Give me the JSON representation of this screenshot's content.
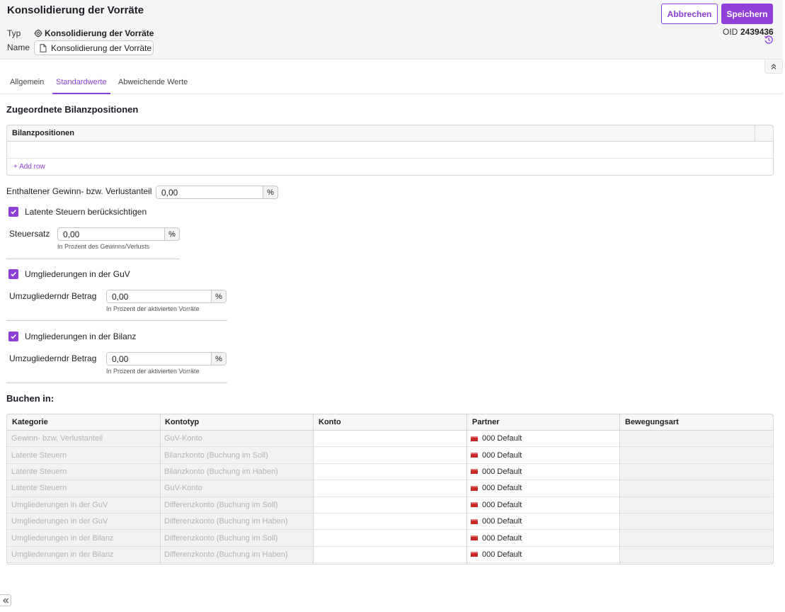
{
  "header": {
    "title": "Konsolidierung der Vorräte",
    "typ_label": "Typ",
    "typ_value": "Konsolidierung der Vorräte",
    "name_label": "Name",
    "name_value": "Konsolidierung der Vorräte",
    "cancel_label": "Abbrechen",
    "save_label": "Speichern",
    "oid_label": "OID",
    "oid_value": "2439436"
  },
  "tabs": [
    {
      "label": "Allgemein"
    },
    {
      "label": "Standardwerte"
    },
    {
      "label": "Abweichende Werte"
    }
  ],
  "active_tab": "Standardwerte",
  "bilanz": {
    "title": "Zugeordnete Bilanzpositionen",
    "column": "Bilanzpositionen",
    "add_row": "+ Add row"
  },
  "gewinn": {
    "label": "Enthaltener Gewinn- bzw. Verlustanteil",
    "value": "0,00",
    "suffix": "%"
  },
  "latente": {
    "checkbox_label": "Latente Steuern berücksichtigen",
    "checked": true,
    "field_label": "Steuersatz",
    "value": "0,00",
    "suffix": "%",
    "hint": "In Prozent des Gewinns/Verlusts"
  },
  "guv": {
    "checkbox_label": "Umgliederungen in der GuV",
    "checked": true,
    "field_label": "Umzugliederndr Betrag",
    "value": "0,00",
    "suffix": "%",
    "hint": "In Prozent der aktivierten Vorräte"
  },
  "bilanz_umgl": {
    "checkbox_label": "Umgliederungen in der Bilanz",
    "checked": true,
    "field_label": "Umzugliederndr Betrag",
    "value": "0,00",
    "suffix": "%",
    "hint": "In Prozent der aktivierten Vorräte"
  },
  "buchen": {
    "title": "Buchen in:",
    "columns": [
      "Kategorie",
      "Kontotyp",
      "Konto",
      "Partner",
      "Bewegungsart"
    ],
    "rows": [
      {
        "kategorie": "Gewinn- bzw. Verlustanteil",
        "kontotyp": "GuV-Konto",
        "konto": "",
        "partner": "000 Default",
        "bewegungsart": ""
      },
      {
        "kategorie": "Latente Steuern",
        "kontotyp": "Bilanzkonto (Buchung im Soll)",
        "konto": "",
        "partner": "000 Default",
        "bewegungsart": ""
      },
      {
        "kategorie": "Latente Steuern",
        "kontotyp": "Bilanzkonto (Buchung im Haben)",
        "konto": "",
        "partner": "000 Default",
        "bewegungsart": ""
      },
      {
        "kategorie": "Latente Steuern",
        "kontotyp": "GuV-Konto",
        "konto": "",
        "partner": "000 Default",
        "bewegungsart": ""
      },
      {
        "kategorie": "Umgliederungen in der GuV",
        "kontotyp": "Differenzkonto (Buchung im Soll)",
        "konto": "",
        "partner": "000 Default",
        "bewegungsart": ""
      },
      {
        "kategorie": "Umgliederungen in der GuV",
        "kontotyp": "Differenzkonto (Buchung im Haben)",
        "konto": "",
        "partner": "000 Default",
        "bewegungsart": ""
      },
      {
        "kategorie": "Umgliederungen in der Bilanz",
        "kontotyp": "Differenzkonto (Buchung im Soll)",
        "konto": "",
        "partner": "000 Default",
        "bewegungsart": ""
      },
      {
        "kategorie": "Umgliederungen in der Bilanz",
        "kontotyp": "Differenzkonto (Buchung im Haben)",
        "konto": "",
        "partner": "000 Default",
        "bewegungsart": ""
      }
    ]
  },
  "icons": {
    "typ": "consolidation-icon",
    "name": "document-icon",
    "history": "history-icon",
    "collapse": "chevrons-up-icon",
    "checkbox": "check-icon",
    "flag": "flag-icon",
    "sidebar_toggle": "chevrons-left-icon"
  },
  "colors": {
    "accent": "#8c3ed6",
    "header_bg": "#f5f5f6",
    "disabled_cell": "#f2f2f3"
  }
}
